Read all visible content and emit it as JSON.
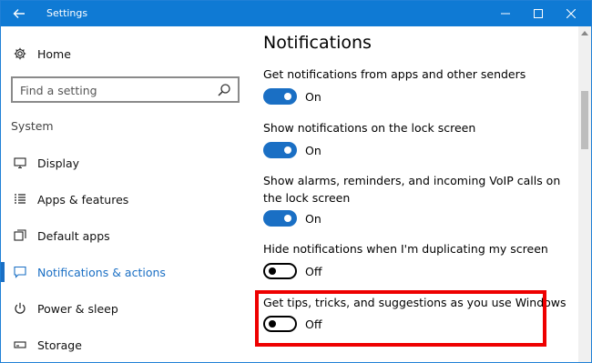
{
  "window": {
    "title": "Settings",
    "back_icon": "arrow-left-icon",
    "minimize_icon": "minimize-icon",
    "maximize_icon": "maximize-icon",
    "close_icon": "close-icon"
  },
  "sidebar": {
    "home_label": "Home",
    "search": {
      "placeholder": "Find a setting",
      "icon": "search-icon"
    },
    "section_label": "System",
    "items": [
      {
        "label": "Display",
        "icon": "display-icon"
      },
      {
        "label": "Apps & features",
        "icon": "apps-list-icon"
      },
      {
        "label": "Default apps",
        "icon": "default-apps-icon"
      },
      {
        "label": "Notifications & actions",
        "icon": "notifications-icon",
        "active": true
      },
      {
        "label": "Power & sleep",
        "icon": "power-icon"
      },
      {
        "label": "Storage",
        "icon": "storage-icon"
      }
    ]
  },
  "main": {
    "title": "Notifications",
    "settings": [
      {
        "description": "Get notifications from apps and other senders",
        "state": "On"
      },
      {
        "description": "Show notifications on the lock screen",
        "state": "On"
      },
      {
        "description": "Show alarms, reminders, and incoming VoIP calls on the lock screen",
        "state": "On"
      },
      {
        "description": "Hide notifications when I'm duplicating my screen",
        "state": "Off"
      },
      {
        "description": "Get tips, tricks, and suggestions as you use Windows",
        "state": "Off"
      }
    ]
  },
  "colors": {
    "accent": "#1a6fc4",
    "titlebar": "#0f7ad4",
    "highlight": "#ee0000"
  }
}
